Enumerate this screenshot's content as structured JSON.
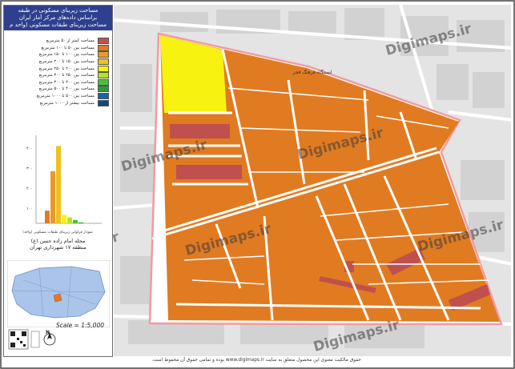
{
  "panel": {
    "title_line1": "مساحت زیربنای مسکونی در طبقه",
    "title_line2": "براساس داده‌های مرکز آمار ایران",
    "legend_title": "مساحت زیربنای طبقات مسکونی (واحد م",
    "legend": [
      {
        "label": "مساحت کمتر از ۵۰ مترمربع",
        "color": "#c0504d"
      },
      {
        "label": "مساحت بین ۵۰ تا ۱۰۰ مترمربع",
        "color": "#e07b22"
      },
      {
        "label": "مساحت بین ۱۰۰ تا ۱۵۰ مترمربع",
        "color": "#e89a2c"
      },
      {
        "label": "مساحت بین ۱۵۰ تا ۲۰۰ مترمربع",
        "color": "#f0c020"
      },
      {
        "label": "مساحت بین ۲۰۰ تا ۲۵۰ مترمربع",
        "color": "#f7f210"
      },
      {
        "label": "مساحت بین ۲۵۰ تا ۳۰۰ مترمربع",
        "color": "#b5e61d"
      },
      {
        "label": "مساحت بین ۳۰۰ تا ۴۰۰ مترمربع",
        "color": "#44c43a"
      },
      {
        "label": "مساحت بین ۴۰۰ تا ۵۰۰ مترمربع",
        "color": "#2d9a3a"
      },
      {
        "label": "مساحت بین ۵۰۰ تا ۱۰۰۰ مترمربع",
        "color": "#1e5fa8"
      },
      {
        "label": "مساحت بیشتر از ۱۰۰۰ مترمربع",
        "color": "#14487a"
      }
    ],
    "hist_labels": [
      "۴۰۰",
      "۳۰۰",
      "۲۰۰",
      "۱۰۰"
    ],
    "hist_values": [
      0.0,
      0.15,
      0.62,
      0.92,
      0.1,
      0.07,
      0.04,
      0.01,
      0.0,
      0.0
    ],
    "hist_caption": "نمودار فراوانی زیربنای طبقات مسکونی (واحد)",
    "place_line1": "محله امام زاده حسن (ع)",
    "place_line2": "منطقه ۱۷ شهرداری تهران",
    "scale": "Scale = 1:5,000",
    "north": "N"
  },
  "map": {
    "label_building": "ایستگاه فرهنگ فجر",
    "watermark": "Digimaps.ir"
  },
  "footer": "حقوق مالکیت معنوی این محصول متعلق به سایت www.digimaps.ir بوده و تمامی حقوق آن محفوظ است."
}
